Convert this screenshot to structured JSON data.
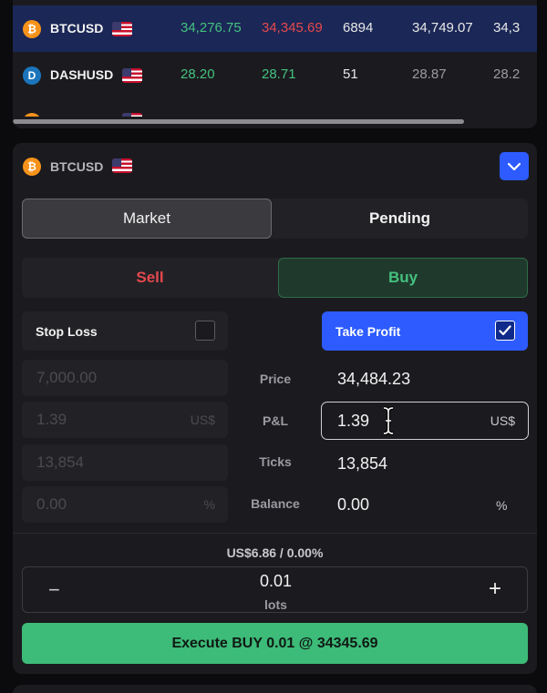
{
  "watchlist": {
    "rows": [
      {
        "symbol": "BTCUSD",
        "icon": "bitcoin-icon",
        "bid": "34,276.75",
        "ask": "34,345.69",
        "volume": "6894",
        "high": "34,749.07",
        "low": "34,3"
      },
      {
        "symbol": "DASHUSD",
        "icon": "dash-icon",
        "bid": "28.20",
        "ask": "28.71",
        "volume": "51",
        "high": "28.87",
        "low": "28.2"
      }
    ]
  },
  "order": {
    "symbol": "BTCUSD",
    "tabs": {
      "market": "Market",
      "pending": "Pending"
    },
    "sides": {
      "sell": "Sell",
      "buy": "Buy"
    },
    "stop_loss": {
      "label": "Stop Loss",
      "checked": false
    },
    "take_profit": {
      "label": "Take Profit",
      "checked": true
    },
    "left_inputs": {
      "price": "7,000.00",
      "pnl": "1.39",
      "pnl_unit": "US$",
      "ticks": "13,854",
      "balance": "0.00",
      "balance_unit": "%"
    },
    "row_labels": {
      "price": "Price",
      "pnl": "P&L",
      "ticks": "Ticks",
      "balance": "Balance"
    },
    "right_values": {
      "price": "34,484.23",
      "pnl": "1.39",
      "pnl_unit": "US$",
      "ticks": "13,854",
      "balance": "0.00",
      "balance_unit": "%"
    },
    "margin_text": "US$6.86 / 0.00%",
    "lots": {
      "amount": "0.01",
      "unit": "lots",
      "minus": "−",
      "plus": "+"
    },
    "execute_label": "Execute BUY 0.01 @ 34345.69"
  },
  "colors": {
    "accent": "#2d5bff",
    "buy": "#44c17f",
    "sell": "#e5484d",
    "execute": "#3dbb78"
  }
}
